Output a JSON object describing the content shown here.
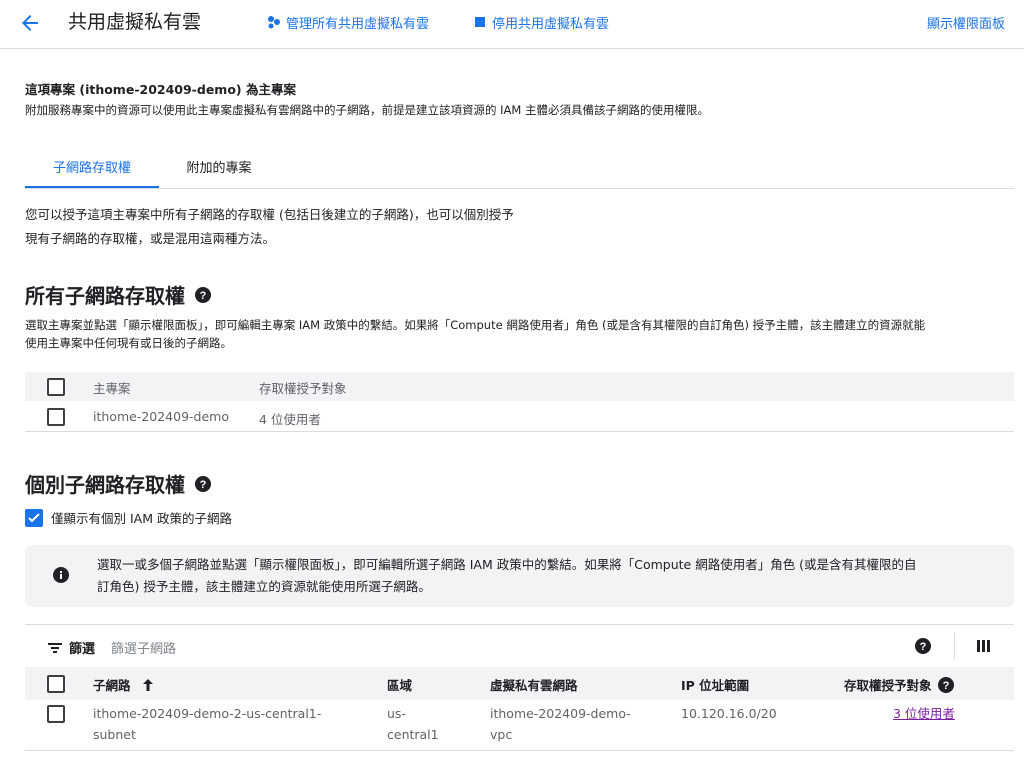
{
  "header": {
    "title": "共用虛擬私有雲",
    "manage_label": "管理所有共用虛擬私有雲",
    "disable_label": "停用共用虛擬私有雲",
    "show_permissions_label": "顯示權限面板"
  },
  "host": {
    "title": "這項專案 (ithome-202409-demo) 為主專案",
    "desc": "附加服務專案中的資源可以使用此主專案虛擬私有雲網路中的子網路，前提是建立該項資源的 IAM 主體必須具備該子網路的使用權限。"
  },
  "tabs": [
    {
      "label": "子網路存取權"
    },
    {
      "label": "附加的專案"
    }
  ],
  "intro": {
    "line1": "您可以授予這項主專案中所有子網路的存取權 (包括日後建立的子網路)，也可以個別授予",
    "line2": "現有子網路的存取權，或是混用這兩種方法。"
  },
  "all_access": {
    "heading": "所有子網路存取權",
    "desc_line1": "選取主專案並點選「顯示權限面板」，即可編輯主專案 IAM 政策中的繫結。如果將「Compute 網路使用者」角色 (或是含有其權限的自訂角色) 授予主體，該主體建立的資源就能",
    "desc_line2": "使用主專案中任何現有或日後的子網路。",
    "columns": [
      "主專案",
      "存取權授予對象"
    ],
    "rows": [
      {
        "project": "ithome-202409-demo",
        "grantees": "4 位使用者"
      }
    ]
  },
  "individual_access": {
    "heading": "個別子網路存取權",
    "checkbox_label": "僅顯示有個別 IAM 政策的子網路",
    "info_line1": "選取一或多個子網路並點選「顯示權限面板」，即可編輯所選子網路 IAM 政策中的繫結。如果將「Compute 網路使用者」角色 (或是含有其權限的自",
    "info_line2": "訂角色) 授予主體，該主體建立的資源就能使用所選子網路。",
    "filter_label": "篩選",
    "filter_placeholder": "篩選子網路",
    "columns": [
      "子網路",
      "區域",
      "虛擬私有雲網路",
      "IP 位址範圍",
      "存取權授予對象"
    ],
    "rows": [
      {
        "subnet_line1": "ithome-202409-demo-2-us-central1-",
        "subnet_line2": "subnet",
        "region_line1": "us-",
        "region_line2": "central1",
        "vpc_line1": "ithome-202409-demo-",
        "vpc_line2": "vpc",
        "ip_range": "10.120.16.0/20",
        "grantees": "3 位使用者"
      }
    ]
  },
  "colors": {
    "accent": "#1a73e8",
    "visited_link": "#7b1fa2",
    "header_bg": "#f1f3f4"
  }
}
